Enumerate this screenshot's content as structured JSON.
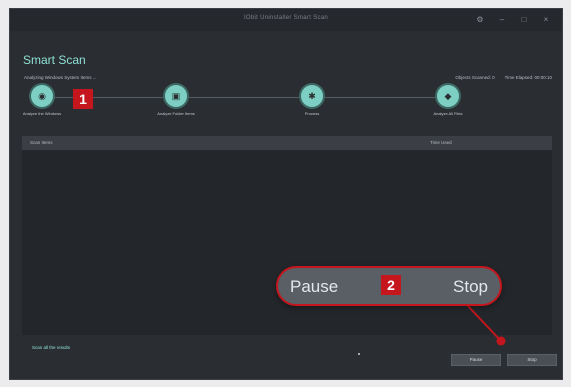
{
  "window": {
    "title": "IObit Uninstaller Smart Scan"
  },
  "window_controls": {
    "settings_icon": "gear-icon",
    "minimize_icon": "minimize-icon",
    "maximize_icon": "maximize-icon",
    "close_icon": "close-icon"
  },
  "header": {
    "title": "Smart Scan",
    "status": "Analyzing Windows System Items ...",
    "objects_scanned": "Objects Scanned: 0",
    "time_elapsed": "Time Elapsed: 00:00:10"
  },
  "steps": [
    {
      "label": "Analyze the Windows",
      "icon": "scan-icon"
    },
    {
      "label": "Analyze Folder Items",
      "icon": "folder-icon"
    },
    {
      "label": "Process",
      "icon": "gear-icon"
    },
    {
      "label": "Analyze All Files",
      "icon": "file-icon"
    }
  ],
  "table": {
    "columns": [
      "Scan Items",
      "Time Used"
    ]
  },
  "footer": {
    "link": "Scan all the results",
    "pause_label": "Pause",
    "stop_label": "Stop"
  },
  "callouts": {
    "badge_1": "1",
    "badge_2": "2",
    "zoom_pause": "Pause",
    "zoom_stop": "Stop"
  },
  "colors": {
    "accent": "#7ccfc2",
    "callout_red": "#c4161c",
    "window_bg": "#2a2d31"
  }
}
